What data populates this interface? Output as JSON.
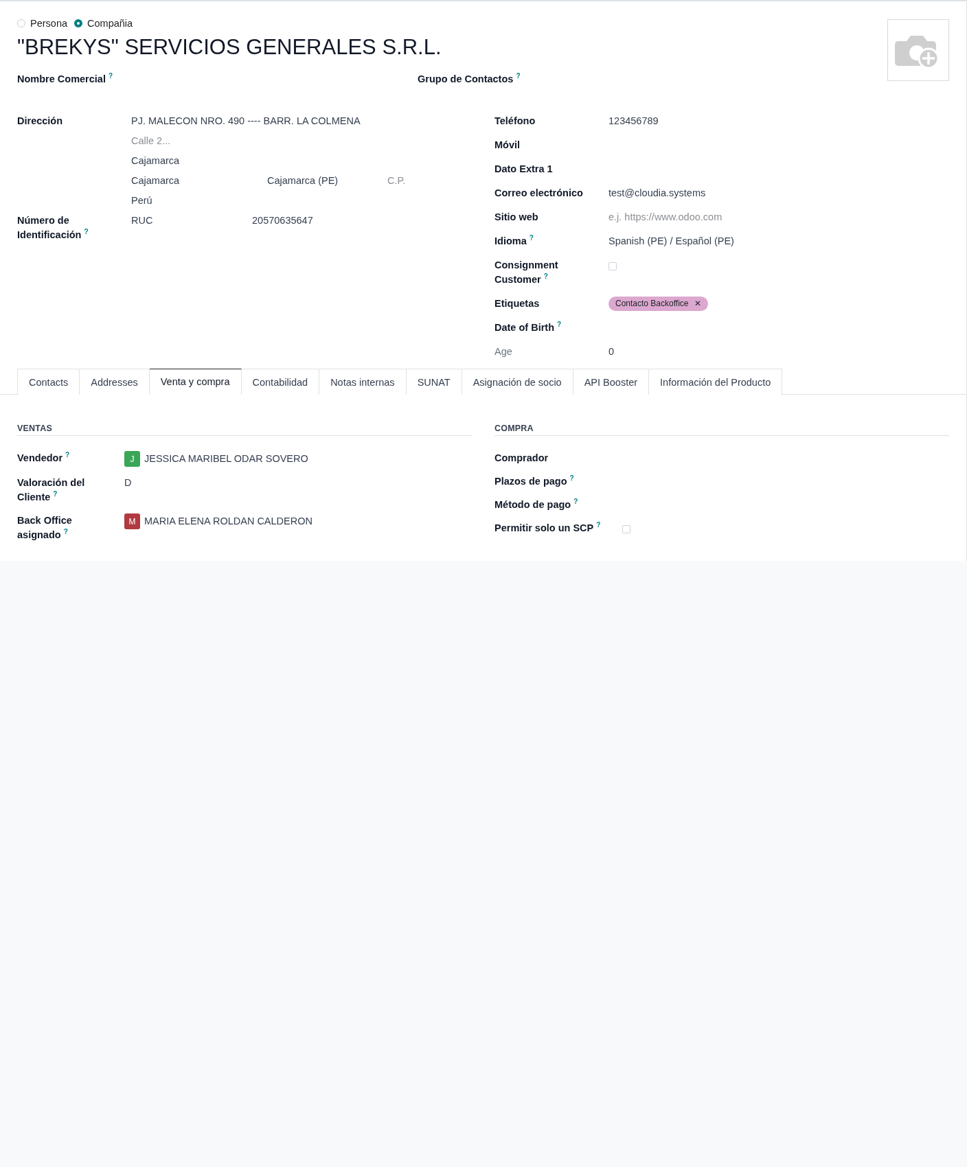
{
  "partner_type": [
    {
      "label": "Persona",
      "selected": false
    },
    {
      "label": "Compañia",
      "selected": true
    }
  ],
  "name": "\"BREKYS\" SERVICIOS GENERALES S.R.L.",
  "top_fields": [
    {
      "label": "Nombre Comercial",
      "help": "?"
    },
    {
      "label": "Grupo de Contactos",
      "help": "?"
    }
  ],
  "address": {
    "label": "Dirección",
    "street": "PJ. MALECON NRO. 490 ---- BARR. LA COLMENA",
    "street2_placeholder": "Calle 2...",
    "district": "Cajamarca",
    "city": "Cajamarca",
    "state": "Cajamarca (PE)",
    "zip_placeholder": "C.P.",
    "country": "Perú"
  },
  "identification": {
    "label": "Número de Identificación",
    "help": "?",
    "type": "RUC",
    "number": "20570635647"
  },
  "right_fields": [
    {
      "kind": "text",
      "label": "Teléfono",
      "value": "123456789"
    },
    {
      "kind": "empty",
      "label": "Móvil"
    },
    {
      "kind": "empty",
      "label": "Dato Extra 1"
    },
    {
      "kind": "text",
      "label": "Correo electrónico",
      "value": "test@cloudia.systems"
    },
    {
      "kind": "placeholder",
      "label": "Sitio web",
      "placeholder": "e.j. https://www.odoo.com"
    },
    {
      "kind": "text",
      "label": "Idioma",
      "help": "?",
      "value": "Spanish (PE) / Español (PE)"
    },
    {
      "kind": "checkbox",
      "label": "Consignment Customer",
      "help": "?",
      "checked": false
    },
    {
      "kind": "tags",
      "label": "Etiquetas",
      "tags": [
        {
          "label": "Contacto Backoffice",
          "remove": "✕",
          "color": "#dca8cf"
        }
      ]
    },
    {
      "kind": "empty",
      "label": "Date of Birth",
      "help": "?"
    },
    {
      "kind": "text",
      "label": "Age",
      "muted": true,
      "value": "0"
    }
  ],
  "tabs": [
    {
      "label": "Contacts",
      "selected": false
    },
    {
      "label": "Addresses",
      "selected": false
    },
    {
      "label": "Venta y compra",
      "selected": true
    },
    {
      "label": "Contabilidad",
      "selected": false
    },
    {
      "label": "Notas internas",
      "selected": false
    },
    {
      "label": "SUNAT",
      "selected": false
    },
    {
      "label": "Asignación de socio",
      "selected": false
    },
    {
      "label": "API Booster",
      "selected": false
    },
    {
      "label": "Información del Producto",
      "selected": false
    }
  ],
  "sections": [
    {
      "title": "VENTAS",
      "fields": [
        {
          "kind": "user",
          "label": "Vendedor",
          "help": "?",
          "initial": "J",
          "color": "#3aa657",
          "value": "JESSICA MARIBEL ODAR SOVERO"
        },
        {
          "kind": "text",
          "label": "Valoración del Cliente",
          "help": "?",
          "value": "D"
        },
        {
          "kind": "user",
          "label": "Back Office asignado",
          "help": "?",
          "initial": "M",
          "color": "#b03a40",
          "value": "MARIA ELENA ROLDAN CALDERON"
        }
      ]
    },
    {
      "title": "COMPRA",
      "fields": [
        {
          "kind": "empty",
          "label": "Comprador"
        },
        {
          "kind": "empty",
          "label": "Plazos de pago",
          "help": "?"
        },
        {
          "kind": "empty",
          "label": "Método de pago",
          "help": "?"
        },
        {
          "kind": "checkbox",
          "label": "Permitir solo un SCP",
          "help": "?",
          "checked": false
        }
      ]
    }
  ]
}
